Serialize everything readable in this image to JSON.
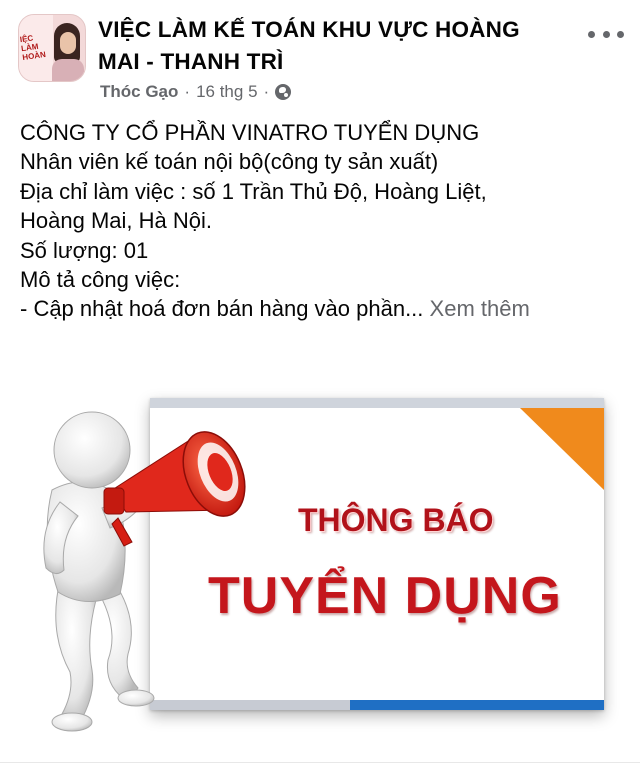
{
  "post": {
    "group_name_line1": "VIỆC LÀM KẾ TOÁN KHU VỰC HOÀNG",
    "group_name_line2": "MAI - THANH TRÌ",
    "author": "Thóc Gạo",
    "date": "16 thg 5",
    "separator": "·",
    "avatar_text": [
      "IỆC LÀM",
      "HOÀN"
    ]
  },
  "body": {
    "lines": [
      "CÔNG TY CỔ PHẦN VINATRO TUYỂN DỤNG",
      "Nhân viên kế toán nội bộ(công ty sản xuất)",
      "Địa chỉ làm việc : số 1 Trần Thủ Độ, Hoàng Liệt,",
      "Hoàng Mai, Hà Nội.",
      "Số lượng: 01",
      "Mô tả công việc:",
      "- Cập nhật hoá đơn bán hàng vào phần..."
    ],
    "see_more": "Xem thêm"
  },
  "image": {
    "notice_title": "THÔNG BÁO",
    "notice_main": "TUYỂN DỤNG"
  },
  "colors": {
    "notice_red": "#c4161c",
    "corner_orange": "#f08a1c",
    "bar_blue": "#1f6fc4",
    "meta_gray": "#65676b"
  },
  "icons": {
    "more": "more-horizontal-icon",
    "audience": "globe-icon",
    "illustration": "megaphone-figure-icon"
  }
}
